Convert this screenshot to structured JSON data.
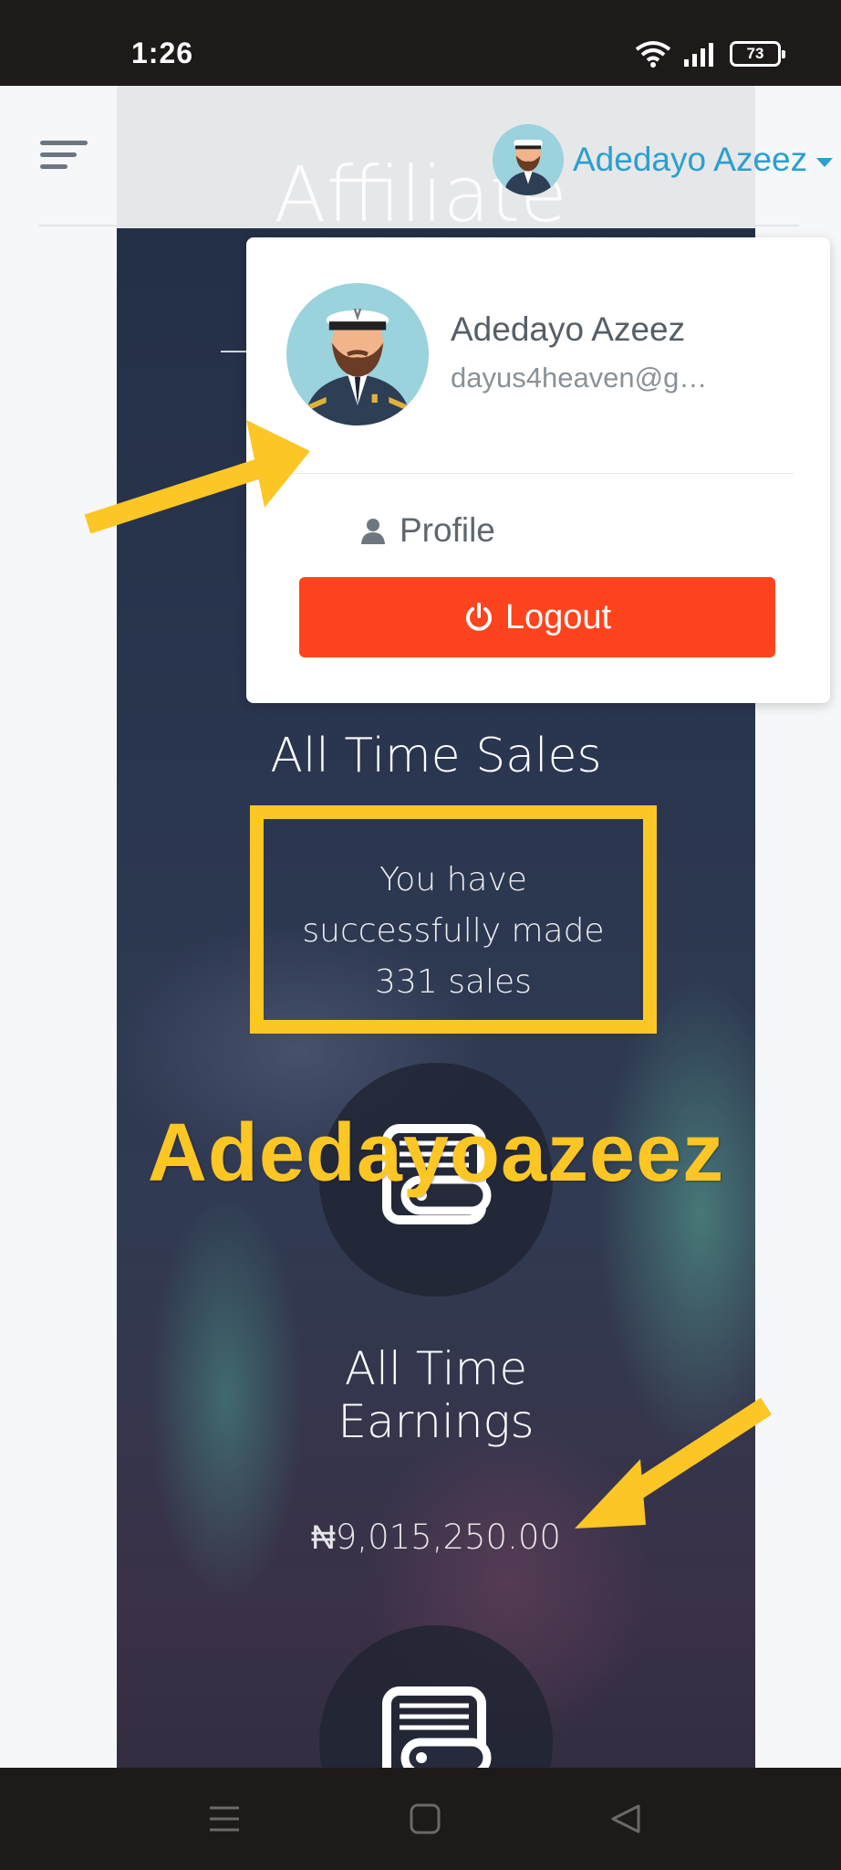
{
  "status_bar": {
    "time": "1:26",
    "battery": "73"
  },
  "header": {
    "user_name": "Adedayo Azeez"
  },
  "hero": {
    "title": "Affiliate"
  },
  "dropdown": {
    "name": "Adedayo Azeez",
    "email": "dayus4heaven@gm...",
    "profile_label": "Profile",
    "logout_label": "Logout"
  },
  "sales": {
    "title": "All Time Sales",
    "line1": "You have",
    "line2": "successfully made",
    "line3": "331 sales"
  },
  "watermark": "Adedayoazeez",
  "earnings": {
    "title_line1": "All Time",
    "title_line2": "Earnings",
    "value": "₦9,015,250.00"
  },
  "colors": {
    "accent_blue": "#2a9fd0",
    "logout_red": "#fe441e",
    "annotation_yellow": "#fcc624"
  },
  "icons": {
    "menu": "hamburger-menu-icon",
    "profile": "user-icon",
    "logout": "power-icon",
    "sales_circle": "wallet-icon"
  }
}
